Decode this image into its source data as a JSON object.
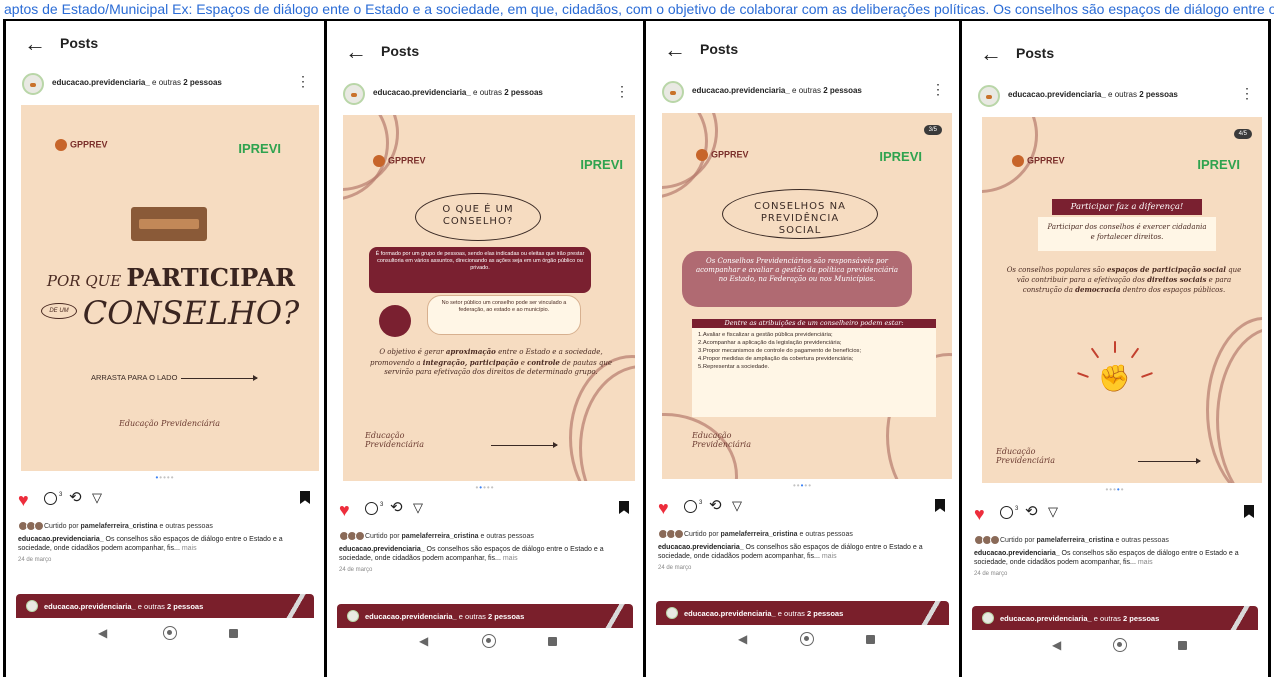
{
  "caption": "aptos de Estado/Municipal Ex: Espaços de diálogo ente o Estado e a sociedade, em que, cidadãos, com o objetivo de colaborar com as deliberações políticas. Os conselhos são espaços de diálogo entre o Estado e a sociedade, onde cidadãos podem acompanhar, fiscalizar e contribuir para a gestão pública, especialmente na",
  "app": {
    "back_glyph": "←",
    "title": "Posts",
    "more_glyph": "⋮"
  },
  "post_header": {
    "account": "educacao.previdenciaria_",
    "others": " e outras ",
    "others_count": "2 pessoas"
  },
  "brand": {
    "logo_text": "GPPREV",
    "iprevi": "IPREVI"
  },
  "slides": [
    {
      "counter": "",
      "heading_small": "POR QUE",
      "heading_big": "PARTICIPAR",
      "de_um": "DE UM",
      "heading_final": "CONSELHO?",
      "swipe_text": "ARRASTA PARA O LADO",
      "footer": "Educação Previdenciária"
    },
    {
      "counter": "",
      "title": "O QUE É UM CONSELHO?",
      "dark_box": "É formado por um grupo de pessoas, sendo elas indicadas ou eleitas que irão prestar consultoria em vários assuntos, direcionando as ações seja em um órgão público ou privado.",
      "light_box": "No setor público um conselho pode ser vinculado a federação, ao estado e ao município.",
      "body_start": "O objetivo é gerar ",
      "body_b1": "aproximação",
      "body_mid1": " entre o Estado e a sociedade, promovendo a ",
      "body_b2": "integração, participação",
      "body_mid2": " e ",
      "body_b3": "controle",
      "body_end": " de pautas que servirão para efetivação dos direitos de determinado grupo.",
      "footer": "Educação Previdenciária"
    },
    {
      "counter": "3/5",
      "title": "CONSELHOS NA PREVIDÊNCIA SOCIAL",
      "dark_box": "Os Conselhos Previdenciários são responsáveis por acompanhar e avaliar a gestão da política previdenciária no Estado, na Federação ou nos Municípios.",
      "list_title": "Dentre as atribuições de um conselheiro podem estar:",
      "list": [
        "1.Avaliar e fiscalizar a gestão pública previdenciária;",
        "2.Acompanhar a aplicação da legislação previdenciária;",
        "3.Propor mecanismos de controle do pagamento de benefícios;",
        "4.Propor medidas de ampliação da cobertura previdenciária;",
        "5.Representar a sociedade."
      ],
      "footer": "Educação Previdenciária"
    },
    {
      "counter": "4/5",
      "title": "Participar faz a diferença!",
      "light_box": "Participar dos conselhos é exercer cidadania e fortalecer direitos.",
      "body_start": "Os conselhos populares são ",
      "body_b1": "espaços de participação social",
      "body_mid1": " que vão contribuir para a efetivação dos ",
      "body_b2": "direitos sociais",
      "body_mid2": " e para construção da ",
      "body_b3": "democracia",
      "body_end": " dentro dos espaços públicos.",
      "fist_glyph": "✊",
      "footer": "Educação Previdenciária"
    }
  ],
  "icons": {
    "heart": "♥",
    "repost": "⟲",
    "send": "▽",
    "comment_count": "3",
    "nav_back": "◀"
  },
  "engagement": {
    "liked_prefix": "Curtido por ",
    "liked_user": "pamelaferreira_cristina",
    "liked_suffix": " e outras pessoas"
  },
  "caption_text": {
    "account": "educacao.previdenciaria_",
    "text": " Os conselhos são espaços de diálogo entre o Estado e a sociedade, onde cidadãos podem acompanhar, fis...",
    "more": " mais",
    "date": "24 de março"
  },
  "colors": {
    "slide_bg": "#f6dcc1",
    "maroon": "#7a2030",
    "iprevi_green": "#2fa34f",
    "like_red": "#ed2d3c",
    "dots_active": "#3b82f6"
  }
}
